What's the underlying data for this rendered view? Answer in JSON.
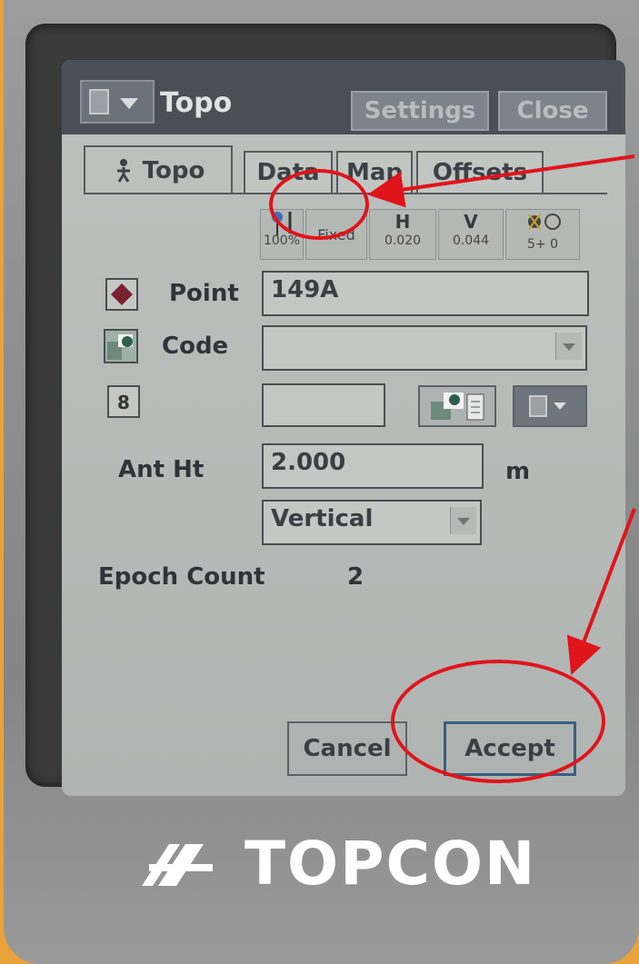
{
  "titlebar": {
    "title": "Topo",
    "settings_label": "Settings",
    "close_label": "Close"
  },
  "tabs": [
    {
      "label": "Topo",
      "active": true
    },
    {
      "label": "Data"
    },
    {
      "label": "Map"
    },
    {
      "label": "Offsets"
    }
  ],
  "status": {
    "percent": "100%",
    "solution": "Fixed",
    "h_label": "H",
    "h_value": "0.020",
    "v_label": "V",
    "v_value": "0.044",
    "satellites": "5+ 0"
  },
  "form": {
    "point_label": "Point",
    "point_value": "149A",
    "code_label": "Code",
    "code_value": "",
    "attr_value": "",
    "ant_ht_label": "Ant Ht",
    "ant_ht_value": "2.000",
    "ant_ht_unit": "m",
    "measure_type": "Vertical",
    "epoch_label": "Epoch Count",
    "epoch_value": "2"
  },
  "buttons": {
    "cancel_label": "Cancel",
    "accept_label": "Accept"
  },
  "brand": "TOPCON",
  "colors": {
    "annotation": "#e0141b",
    "body": "#e8a33a"
  }
}
